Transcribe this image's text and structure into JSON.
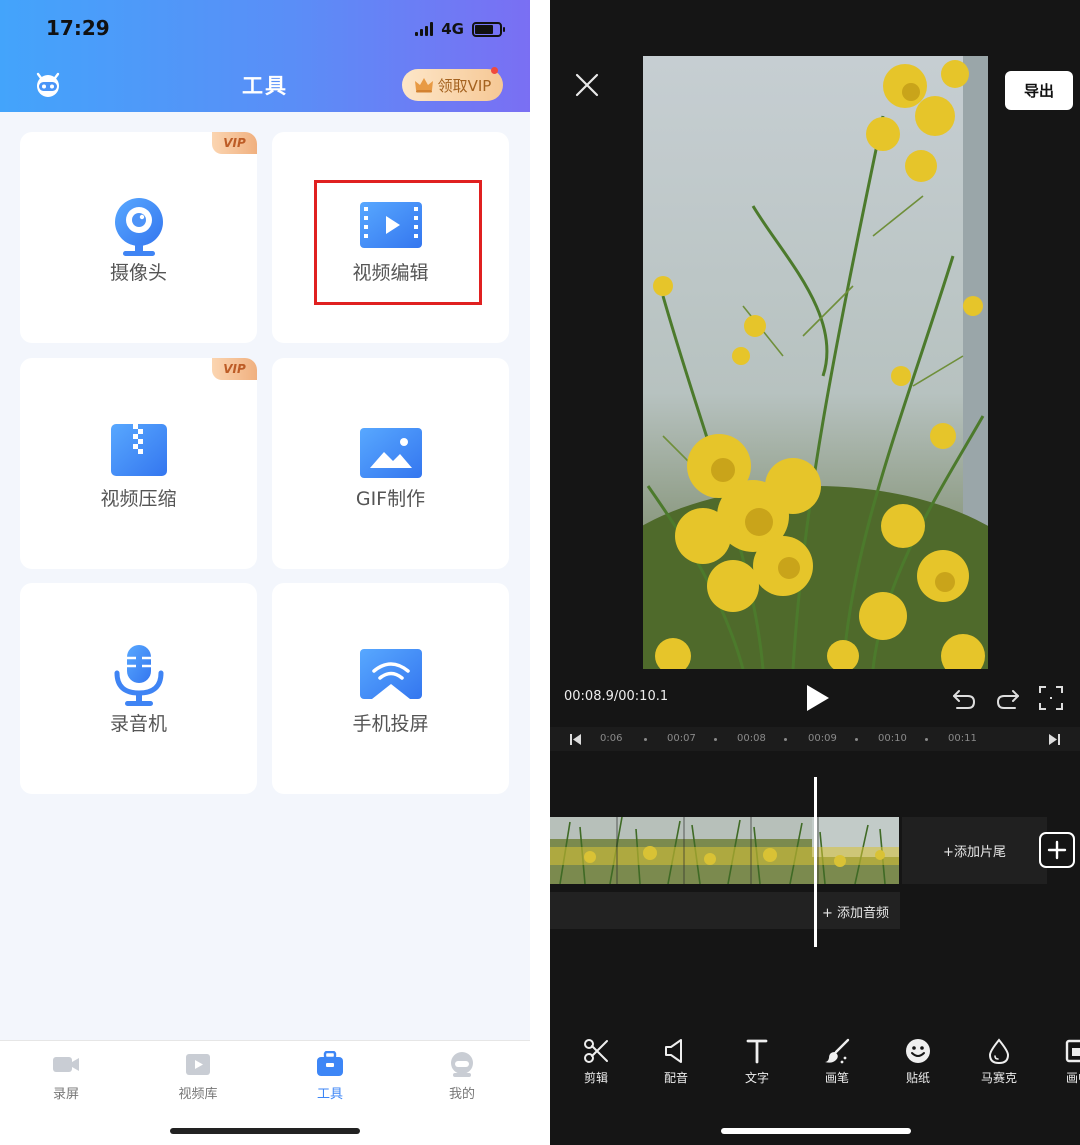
{
  "left": {
    "status": {
      "time": "17:29",
      "network": "4G"
    },
    "header": {
      "title": "工具",
      "vip_button": "领取VIP"
    },
    "vip_tag": "VIP",
    "tools": [
      {
        "label": "摄像头",
        "icon": "webcam-icon",
        "vip": true
      },
      {
        "label": "视频编辑",
        "icon": "video-film-icon",
        "vip": false,
        "highlighted": true
      },
      {
        "label": "视频压缩",
        "icon": "zip-file-icon",
        "vip": true
      },
      {
        "label": "GIF制作",
        "icon": "image-icon",
        "vip": false
      },
      {
        "label": "录音机",
        "icon": "microphone-icon",
        "vip": false
      },
      {
        "label": "手机投屏",
        "icon": "cast-screen-icon",
        "vip": false
      }
    ],
    "tabbar": [
      {
        "label": "录屏",
        "icon": "video-camera-icon",
        "active": false
      },
      {
        "label": "视频库",
        "icon": "video-library-icon",
        "active": false
      },
      {
        "label": "工具",
        "icon": "toolbox-icon",
        "active": true
      },
      {
        "label": "我的",
        "icon": "user-icon",
        "active": false
      }
    ],
    "colors": {
      "accent": "#3d86f6",
      "header_start": "#43a4fb",
      "header_end": "#7a6ff3",
      "highlight_box": "#e02020"
    }
  },
  "right": {
    "export_label": "导出",
    "time_readout": "00:08.9/00:10.1",
    "ruler_ticks": [
      "0:06",
      "00:07",
      "00:08",
      "00:09",
      "00:10",
      "00:11"
    ],
    "add_tail": "+添加片尾",
    "add_audio": "+ 添加音频",
    "tools": [
      {
        "label": "剪辑",
        "icon": "scissors-icon"
      },
      {
        "label": "配音",
        "icon": "speaker-icon"
      },
      {
        "label": "文字",
        "icon": "text-icon"
      },
      {
        "label": "画笔",
        "icon": "brush-icon"
      },
      {
        "label": "贴纸",
        "icon": "sticker-icon"
      },
      {
        "label": "马赛克",
        "icon": "mosaic-drop-icon"
      },
      {
        "label": "画中",
        "icon": "picture-in-picture-icon"
      }
    ]
  }
}
